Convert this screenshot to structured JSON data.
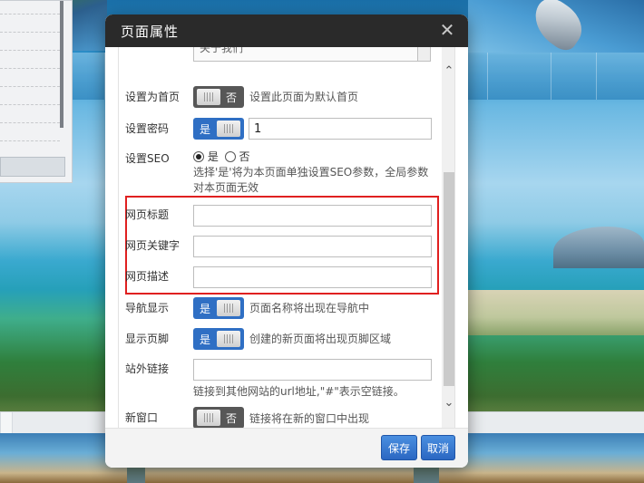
{
  "dialog": {
    "title": "页面属性",
    "close_symbol": "✕",
    "top_field_partial": "关于我们"
  },
  "fields": {
    "homepage": {
      "label": "设置为首页",
      "toggle": "否",
      "state": "off",
      "desc": "设置此页面为默认首页"
    },
    "password": {
      "label": "设置密码",
      "toggle": "是",
      "state": "on",
      "value": "1"
    },
    "seo": {
      "label": "设置SEO",
      "option_yes": "是",
      "option_no": "否",
      "selected": "是",
      "desc_line1": "选择'是'将为本页面单独设置SEO参数，全局参数",
      "desc_line2": "对本页面无效"
    },
    "page_title": {
      "label": "网页标题",
      "value": ""
    },
    "keywords": {
      "label": "网页关键字",
      "value": ""
    },
    "description": {
      "label": "网页描述",
      "value": ""
    },
    "nav_display": {
      "label": "导航显示",
      "toggle": "是",
      "state": "on",
      "desc": "页面名称将出现在导航中"
    },
    "footer_display": {
      "label": "显示页脚",
      "toggle": "是",
      "state": "on",
      "desc": "创建的新页面将出现页脚区域"
    },
    "external_link": {
      "label": "站外链接",
      "value": "",
      "desc": "链接到其他网站的url地址,\"#\"表示空链接。"
    },
    "new_window": {
      "label": "新窗口",
      "toggle": "否",
      "state": "off",
      "desc": "链接将在新的窗口中出现"
    }
  },
  "footer": {
    "save_label": "保存",
    "cancel_label": "取消"
  },
  "icons": {
    "scroll_up": "chevron-up-icon",
    "scroll_down": "chevron-down-icon",
    "close": "close-icon"
  },
  "colors": {
    "header_bg": "#2a2a2a",
    "toggle_on": "#2f6fc4",
    "toggle_off": "#575757",
    "highlight_box": "#e02020",
    "button_blue": "#2b67c2"
  }
}
